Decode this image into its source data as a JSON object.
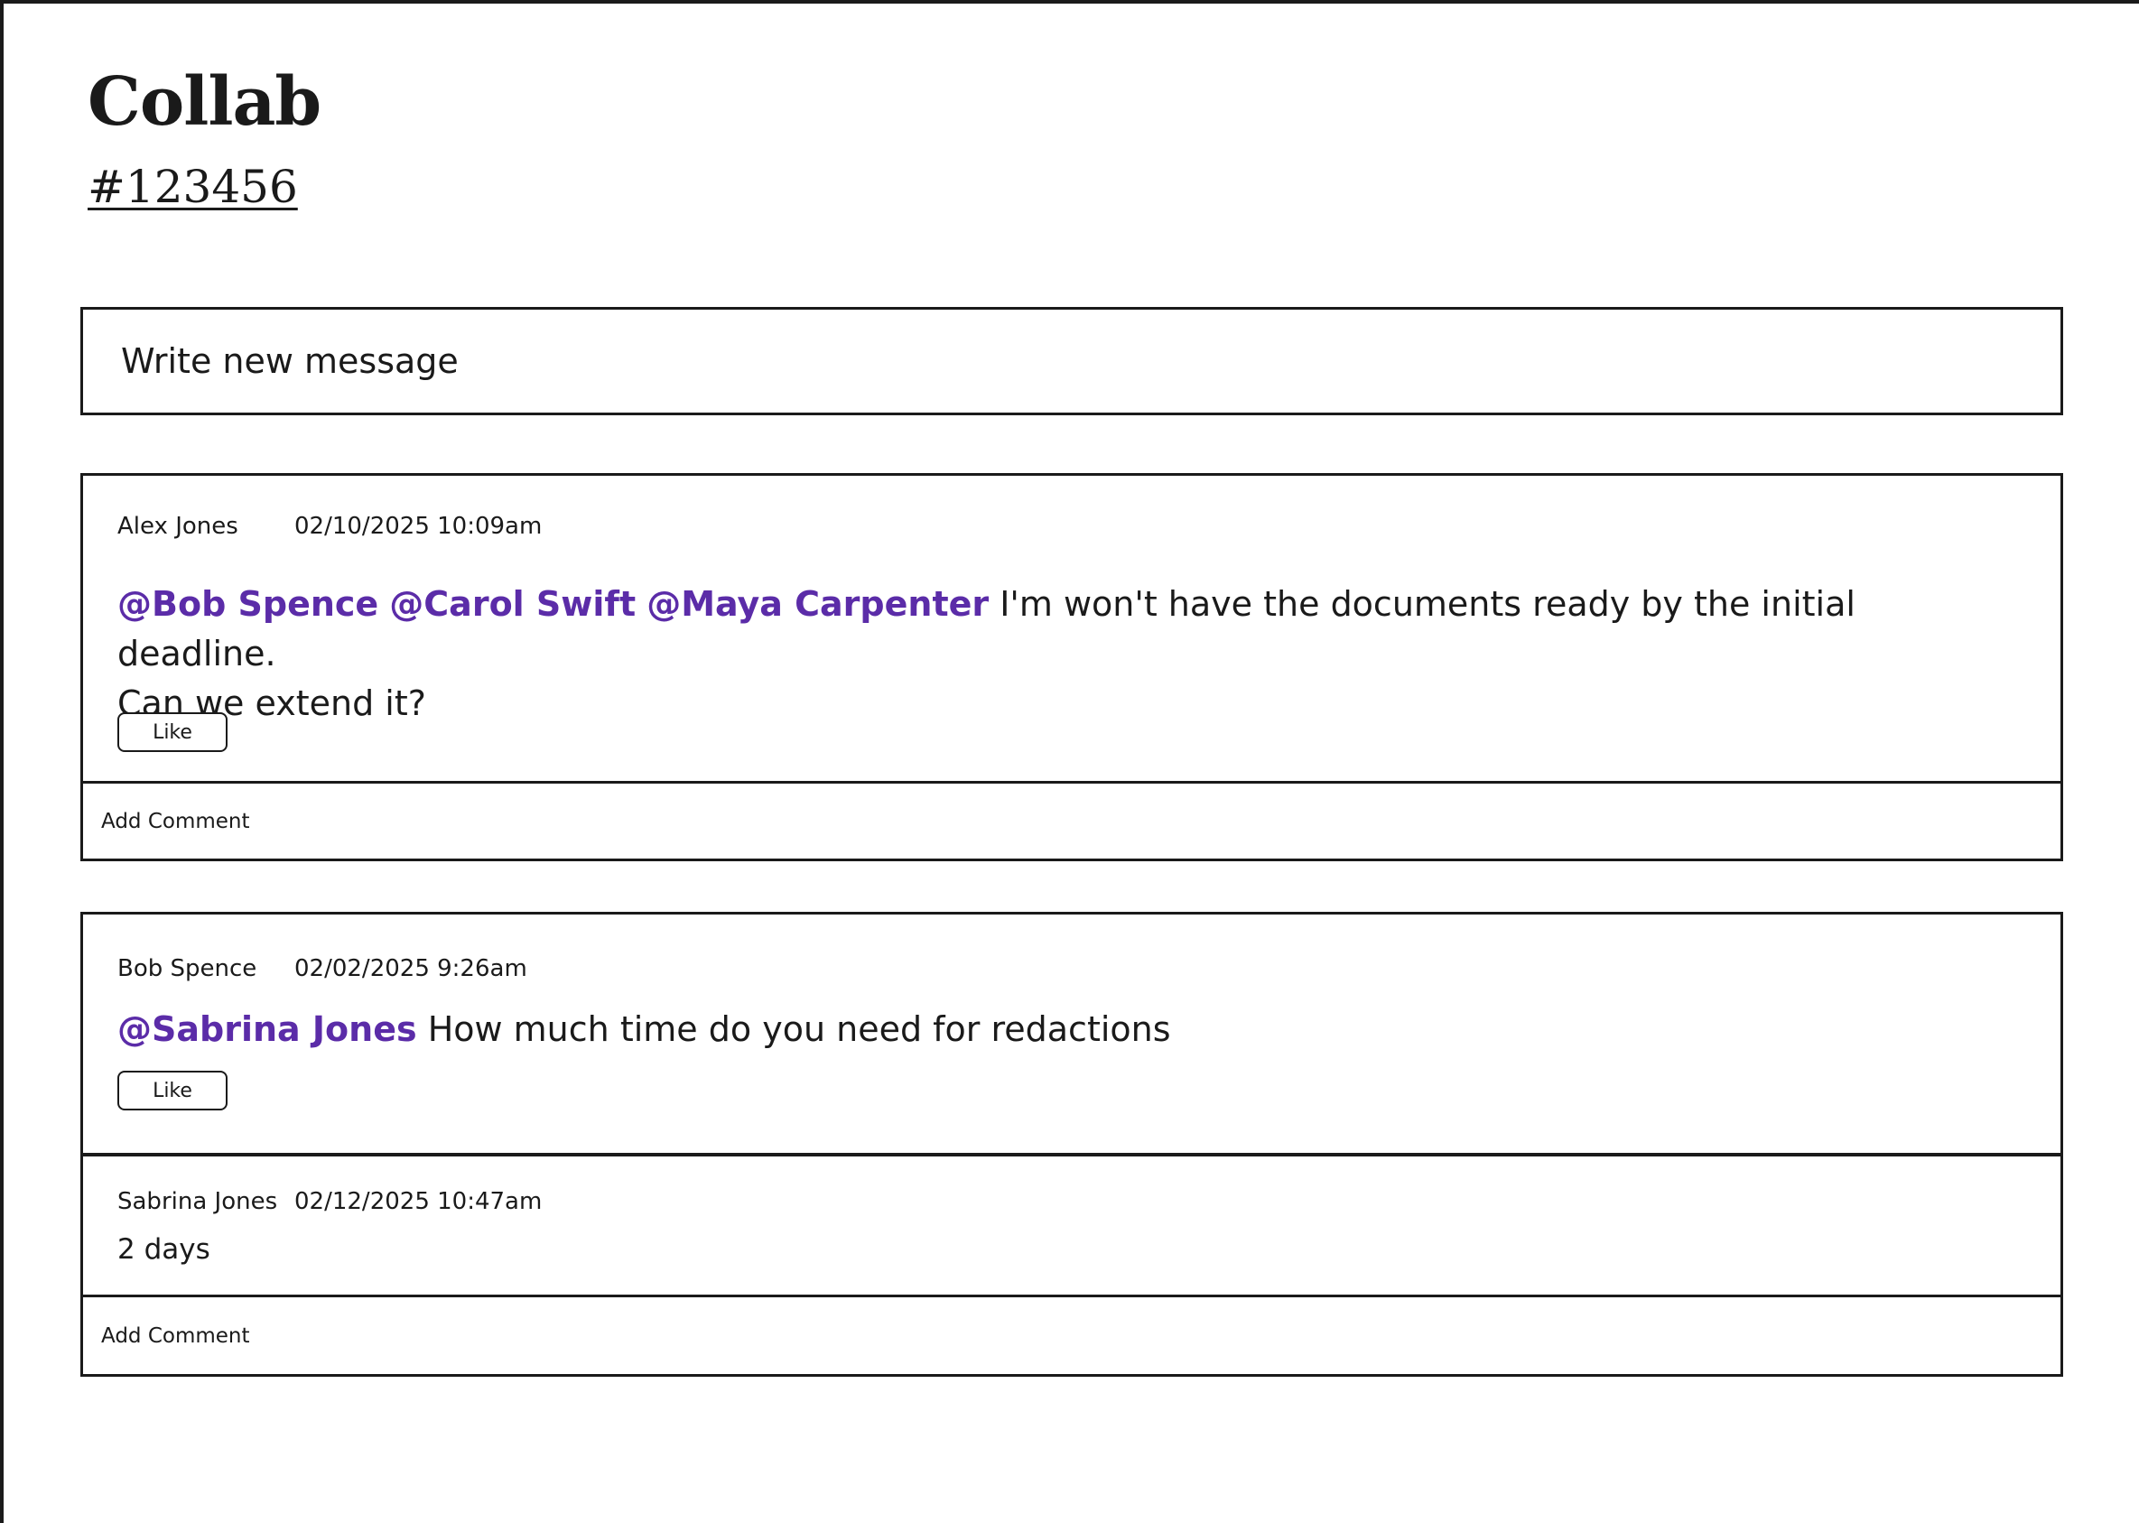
{
  "app": {
    "title": "Collab",
    "channel_id": "#123456"
  },
  "composer": {
    "placeholder": "Write new message"
  },
  "threads": [
    {
      "author": "Alex Jones",
      "timestamp": "02/10/2025 10:09am",
      "mentions": [
        "@Bob Spence",
        "@Carol Swift",
        "@Maya Carpenter"
      ],
      "text_line1": "I'm won't have the documents ready by the  initial deadline.",
      "text_line2": "Can we extend it?",
      "like_label": "Like",
      "add_comment_label": "Add Comment"
    },
    {
      "author": "Bob Spence",
      "timestamp": "02/02/2025 9:26am",
      "mentions": [
        "@Sabrina Jones"
      ],
      "text": "How much time do you need for redactions",
      "like_label": "Like",
      "replies": [
        {
          "author": "Sabrina Jones",
          "timestamp": "02/12/2025 10:47am",
          "text": "2 days"
        }
      ],
      "add_comment_label": "Add Comment"
    }
  ],
  "colors": {
    "mention": "#5b2ca8",
    "border": "#1a1a1a",
    "background": "#ffffff"
  }
}
